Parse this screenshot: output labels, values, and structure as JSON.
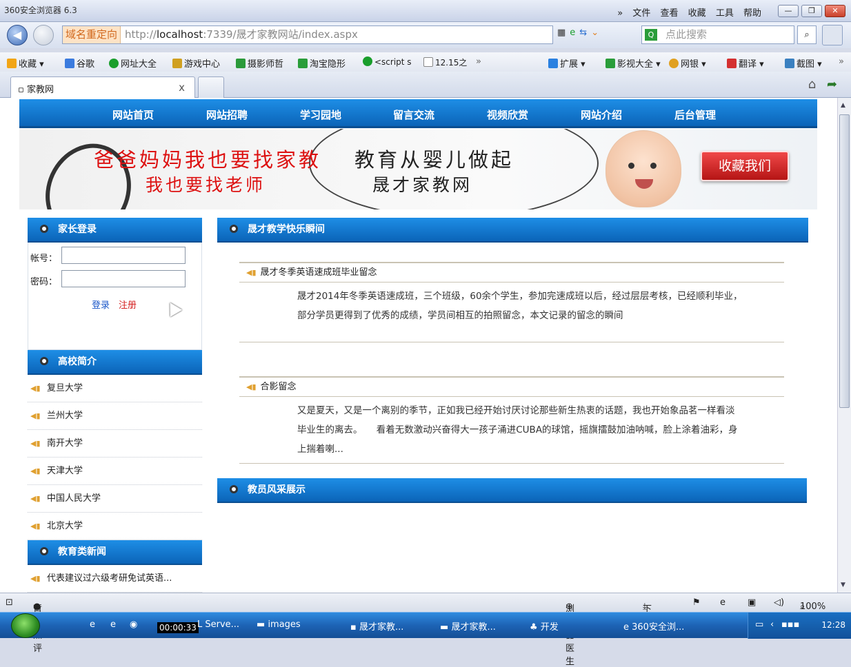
{
  "browser": {
    "app_name": "360安全浏览器 6.3",
    "menus": [
      "»",
      "文件",
      "查看",
      "收藏",
      "工具",
      "帮助"
    ],
    "redirect_label": "域名重定向",
    "url_prefix": "http://",
    "url_host": "localhost",
    "url_rest": ":7339/晟才家教网站/index.aspx",
    "search_placeholder": "点此搜索",
    "tab_title": "家教网",
    "tab_close": "x"
  },
  "favorites": [
    {
      "label": "收藏",
      "color": "#f2a516"
    },
    {
      "label": "谷歌",
      "color": "#3b7bde"
    },
    {
      "label": "网址大全",
      "color": "#1a9e2c"
    },
    {
      "label": "游戏中心",
      "color": "#d0a020"
    },
    {
      "label": "摄影师哲",
      "color": "#2b9a3a"
    },
    {
      "label": "淘宝隐形",
      "color": "#2a9d3a"
    },
    {
      "label": "<script s",
      "color": "#1a9e2c"
    },
    {
      "label": "12.15之",
      "color": "#ffffff"
    },
    {
      "label": "»",
      "color": ""
    }
  ],
  "favorites_right": [
    {
      "label": "扩展",
      "color": "#2a80e0"
    },
    {
      "label": "影视大全",
      "color": "#2a9d3a"
    },
    {
      "label": "网银",
      "color": "#e0a020"
    },
    {
      "label": "翻译",
      "color": "#d43030"
    },
    {
      "label": "截图",
      "color": "#3a80c0"
    },
    {
      "label": "»",
      "color": ""
    }
  ],
  "site": {
    "nav": [
      "网站首页",
      "网站招聘",
      "学习园地",
      "留言交流",
      "视频欣赏",
      "网站介绍",
      "后台管理"
    ],
    "banner": {
      "line1": "爸爸妈妈我也要找家教",
      "line2": "我也要找老师",
      "line3": "教育从婴儿做起",
      "line4": "晟才家教网",
      "fav_button": "收藏我们"
    },
    "login": {
      "heading": "家长登录",
      "account_label": "帐号：",
      "password_label": "密码：",
      "login_link": "登录",
      "register_link": "注册"
    },
    "universities": {
      "heading": "高校简介",
      "items": [
        "复旦大学",
        "兰州大学",
        "南开大学",
        "天津大学",
        "中国人民大学",
        "北京大学"
      ]
    },
    "news": {
      "heading": "教育类新闻",
      "items": [
        "代表建议过六级考研免试英语..."
      ]
    },
    "moments": {
      "heading": "晟才教学快乐瞬间",
      "articles": [
        {
          "title": "晟才冬季英语速成班毕业留念",
          "body": "晟才2014年冬季英语速成班，三个班级，60余个学生，参加完速成班以后，经过层层考核，已经顺利毕业，部分学员更得到了优秀的成绩，学员间相互的拍照留念，本文记录的留念的瞬间"
        },
        {
          "title": "合影留念",
          "body": "又是夏天，又是一个离别的季节，正如我已经开始讨厌讨论那些新生热衷的话题，我也开始象品茗一样看淡毕业生的离去。　　看着无数激动兴奋得大一孩子涌进CUBA的球馆，摇旗擂鼓加油呐喊，脸上涂着油彩，身上揣着喇..."
        }
      ]
    },
    "teachers": {
      "heading": "教员风采展示"
    }
  },
  "statusbar": {
    "rating": "暂无点评",
    "doctor": "浏览器医生",
    "download": "下载",
    "zoom": "100%"
  },
  "taskbar": {
    "timer": "00:00:33",
    "items": [
      "L Serve...",
      "images",
      "晟才家教...",
      "晟才家教...",
      "开发",
      "360安全浏..."
    ],
    "clock": "12:28"
  },
  "colors": {
    "nav_blue": "#1272cc",
    "banner_red": "#d11111",
    "link_blue": "#1a56c8",
    "link_red": "#d42020"
  }
}
